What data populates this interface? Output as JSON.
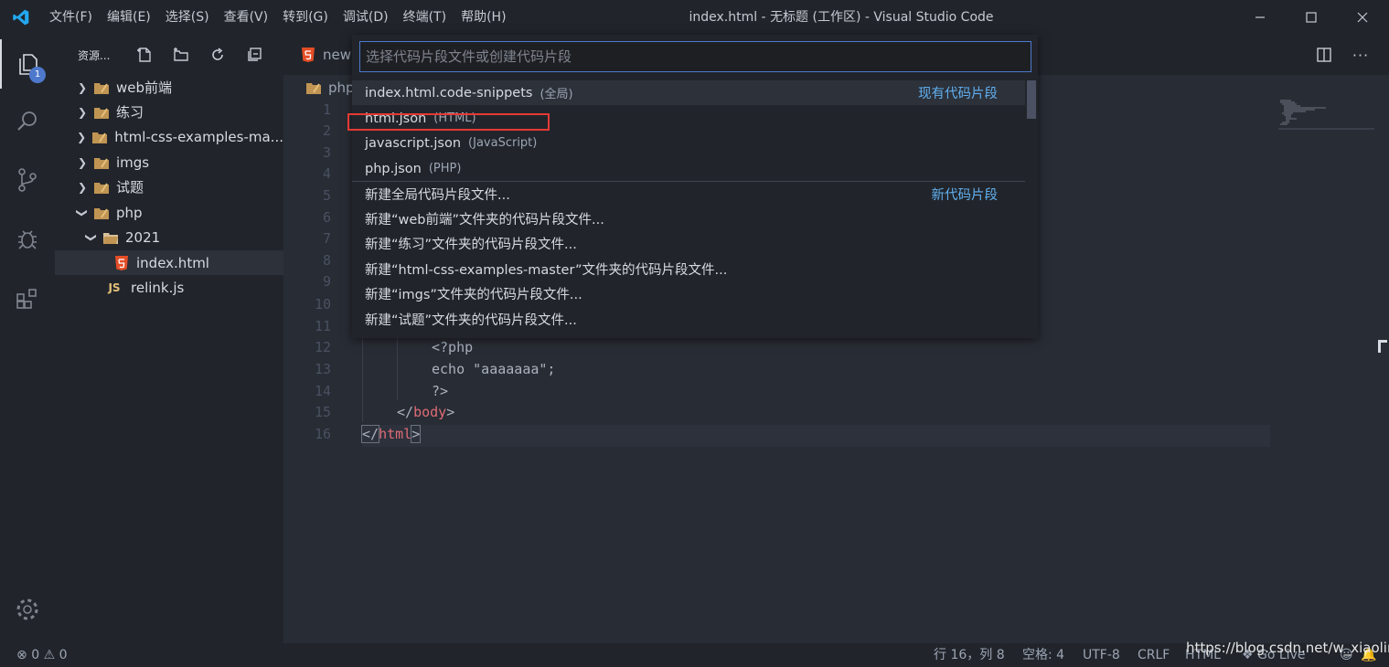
{
  "window": {
    "title": "index.html - 无标题 (工作区) - Visual Studio Code",
    "menu": [
      "文件(F)",
      "编辑(E)",
      "选择(S)",
      "查看(V)",
      "转到(G)",
      "调试(D)",
      "终端(T)",
      "帮助(H)"
    ]
  },
  "activity_bar": {
    "explorer_badge": "1",
    "items": [
      "explorer",
      "search",
      "source-control",
      "debug",
      "extensions",
      "settings"
    ]
  },
  "sidebar": {
    "title": "资源...",
    "tree": [
      {
        "label": "web前端",
        "type": "folder",
        "expanded": false
      },
      {
        "label": "练习",
        "type": "folder",
        "expanded": false
      },
      {
        "label": "html-css-examples-ma...",
        "type": "folder",
        "expanded": false
      },
      {
        "label": "imgs",
        "type": "folder",
        "expanded": false
      },
      {
        "label": "试题",
        "type": "folder",
        "expanded": false
      },
      {
        "label": "php",
        "type": "folder",
        "expanded": true
      },
      {
        "label": "2021",
        "type": "folder",
        "expanded": true
      },
      {
        "label": "index.html",
        "type": "html",
        "selected": true
      },
      {
        "label": "relink.js",
        "type": "js"
      }
    ],
    "js_icon_text": "JS"
  },
  "editor": {
    "tab_label": "newb",
    "breadcrumb": "php",
    "line_numbers": [
      "1",
      "2",
      "3",
      "4",
      "5",
      "6",
      "7",
      "8",
      "9",
      "10",
      "11",
      "12",
      "13",
      "14",
      "15",
      "16"
    ],
    "visible_lines": {
      "l12": "<?php",
      "l13": "echo \"aaaaaaa\";",
      "l14": "?>",
      "l15_open": "</",
      "l15_tag": "body",
      "l15_close": ">",
      "l16_open": "</",
      "l16_tag": "html",
      "l16_close": ">"
    }
  },
  "quick_pick": {
    "placeholder": "选择代码片段文件或创建代码片段",
    "existing_group_label": "现有代码片段",
    "new_group_label": "新代码片段",
    "existing": [
      {
        "label": "index.html.code-snippets",
        "desc": "(全局)"
      },
      {
        "label": "html.json",
        "desc": "(HTML)"
      },
      {
        "label": "javascript.json",
        "desc": "(JavaScript)"
      },
      {
        "label": "php.json",
        "desc": "(PHP)"
      }
    ],
    "new": [
      "新建全局代码片段文件...",
      "新建“web前端”文件夹的代码片段文件...",
      "新建“练习”文件夹的代码片段文件...",
      "新建“html-css-examples-master”文件夹的代码片段文件...",
      "新建“imgs”文件夹的代码片段文件...",
      "新建“试题”文件夹的代码片段文件..."
    ]
  },
  "status_bar": {
    "errors": "0",
    "warnings": "0",
    "position": "行 16，列 8",
    "spaces": "空格: 4",
    "encoding": "UTF-8",
    "eol": "CRLF",
    "language": "HTML",
    "go_live": "Go Live"
  },
  "watermark": "https://blog.csdn.net/w_xiaolin",
  "colors": {
    "accent": "#4d78cc",
    "link": "#61afef",
    "annotation_box": "#e53935",
    "tag": "#e06c75"
  }
}
